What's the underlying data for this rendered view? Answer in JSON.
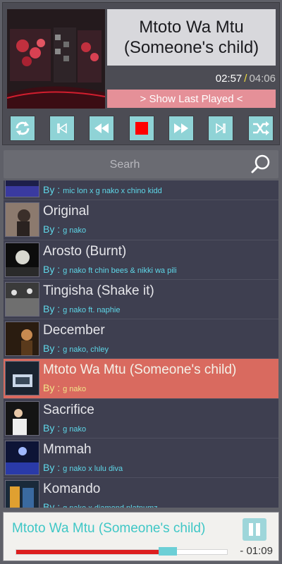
{
  "player": {
    "title": "Mtoto Wa Mtu (Someone's child)",
    "elapsed": "02:57",
    "separator": "/",
    "total": "04:06",
    "show_last_played": "> Show Last Played <"
  },
  "controls": [
    {
      "name": "repeat-button",
      "icon": "repeat-icon"
    },
    {
      "name": "previous-button",
      "icon": "skip-previous-icon"
    },
    {
      "name": "rewind-button",
      "icon": "rewind-icon"
    },
    {
      "name": "stop-button",
      "icon": "stop-icon"
    },
    {
      "name": "fast-forward-button",
      "icon": "fast-forward-icon"
    },
    {
      "name": "next-button",
      "icon": "skip-next-icon"
    },
    {
      "name": "shuffle-button",
      "icon": "shuffle-icon"
    }
  ],
  "search": {
    "placeholder": "Searh"
  },
  "songs": [
    {
      "title": "",
      "by_label": "By :",
      "artist": "mic lon x g nako x chino kidd",
      "active": false
    },
    {
      "title": "Original",
      "by_label": "By :",
      "artist": "g nako",
      "active": false
    },
    {
      "title": "Arosto (Burnt)",
      "by_label": "By :",
      "artist": "g nako ft chin bees & nikki wa pili",
      "active": false
    },
    {
      "title": "Tingisha (Shake it)",
      "by_label": "By :",
      "artist": "g nako ft. naphie",
      "active": false
    },
    {
      "title": "December",
      "by_label": "By :",
      "artist": "g nako, chley",
      "active": false
    },
    {
      "title": "Mtoto Wa Mtu (Someone's child)",
      "by_label": "By :",
      "artist": "g nako",
      "active": true
    },
    {
      "title": "Sacrifice",
      "by_label": "By :",
      "artist": "g nako",
      "active": false
    },
    {
      "title": "Mmmah",
      "by_label": "By :",
      "artist": "g nako x lulu diva",
      "active": false
    },
    {
      "title": "Komando",
      "by_label": "By :",
      "artist": "g nako x diamond platnumz",
      "active": false
    }
  ],
  "now_playing": {
    "title": "Mtoto Wa Mtu (Someone's child)",
    "remaining": "- 01:09",
    "progress": 0.72
  },
  "colors": {
    "accent": "#8fd3d6",
    "active_row": "#d96a5f",
    "progress_fill": "#dd1e1e",
    "stop_red": "#ff0000"
  }
}
